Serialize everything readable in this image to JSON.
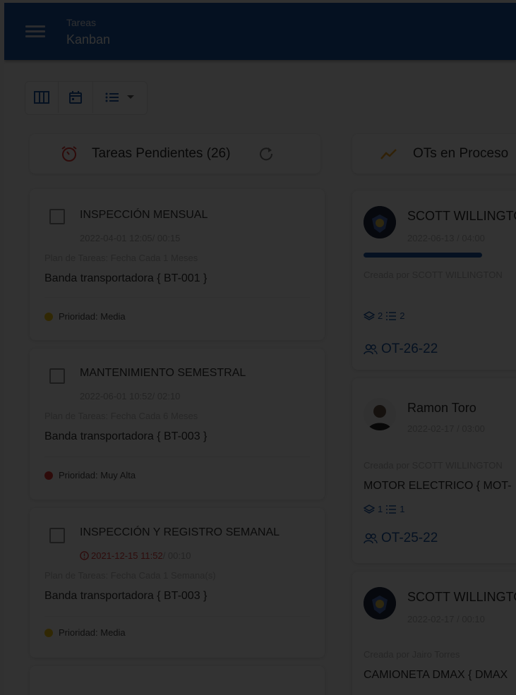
{
  "app": {
    "subtitle": "Tareas",
    "title": "Kanban"
  },
  "toolbar": {
    "buttons": [
      {
        "icon": "kanban-columns-icon"
      },
      {
        "icon": "calendar-icon"
      },
      {
        "icon": "list-icon"
      }
    ]
  },
  "columns": {
    "pending": {
      "title": "Tareas Pendientes (26)",
      "icon": "timer-icon",
      "action_icon": "refresh-icon"
    },
    "in_process": {
      "title": "OTs en Proceso",
      "icon": "trending-icon"
    }
  },
  "tasks": [
    {
      "title": "INSPECCIÓN MENSUAL",
      "date": "2022-04-01 12:05",
      "duration": "/ 00:15",
      "overdue": false,
      "plan": "Plan de Tareas: Fecha Cada 1 Meses",
      "asset": "Banda transportadora { BT-001 }",
      "priority": "Prioridad: Media",
      "priority_color": "#f5c518"
    },
    {
      "title": "MANTENIMIENTO SEMESTRAL",
      "date": "2022-06-01 10:52",
      "duration": "/ 02:10",
      "overdue": false,
      "plan": "Plan de Tareas: Fecha Cada 6 Meses",
      "asset": "Banda transportadora { BT-003 }",
      "priority": "Prioridad: Muy Alta",
      "priority_color": "#e53935"
    },
    {
      "title": "INSPECCIÓN Y REGISTRO SEMANAL",
      "date": "2021-12-15 11:52",
      "duration": "/ 00:10",
      "overdue": true,
      "plan": "Plan de Tareas: Fecha Cada 1 Semana(s)",
      "asset": "Banda transportadora { BT-003 }",
      "priority": "Prioridad: Media",
      "priority_color": "#f5c518"
    }
  ],
  "ots": [
    {
      "user": "SCOTT WILLINGTON",
      "date": "2022-06-13 / 04:00",
      "progress": 0.75,
      "created_by": "Creada por SCOTT WILLINGTON",
      "asset": "",
      "count_layers": "2",
      "count_tasks": "2",
      "code": "OT-26-22"
    },
    {
      "user": "Ramon Toro",
      "date": "2022-02-17 / 03:00",
      "created_by": "Creada por SCOTT WILLINGTON",
      "asset": "MOTOR ELECTRICO { MOT-",
      "count_layers": "1",
      "count_tasks": "1",
      "code": "OT-25-22"
    },
    {
      "user": "SCOTT WILLINGTON",
      "date": "2022-02-17 / 00:10",
      "created_by": "Creada por Jairo Torres",
      "asset": "CAMIONETA DMAX { DMAX"
    }
  ],
  "colors": {
    "primary": "#1c57a6",
    "overdue": "#e23b3b",
    "overlay": "rgba(0,0,0,0.80)"
  }
}
